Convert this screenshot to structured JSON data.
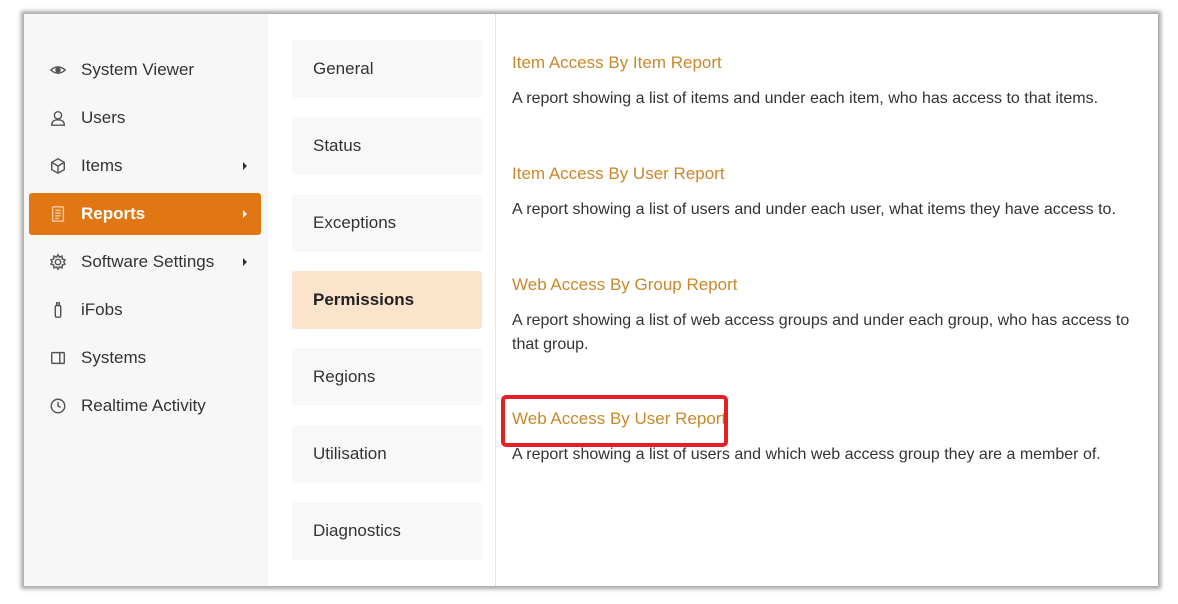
{
  "sidebar": {
    "items": [
      {
        "label": "System Viewer",
        "icon": "eye-icon",
        "has_submenu": false
      },
      {
        "label": "Users",
        "icon": "user-icon",
        "has_submenu": false
      },
      {
        "label": "Items",
        "icon": "cube-icon",
        "has_submenu": true
      },
      {
        "label": "Reports",
        "icon": "report-icon",
        "has_submenu": true,
        "active": true
      },
      {
        "label": "Software Settings",
        "icon": "gear-icon",
        "has_submenu": true
      },
      {
        "label": "iFobs",
        "icon": "fob-icon",
        "has_submenu": false
      },
      {
        "label": "Systems",
        "icon": "window-icon",
        "has_submenu": false
      },
      {
        "label": "Realtime Activity",
        "icon": "clock-icon",
        "has_submenu": false
      }
    ]
  },
  "tabs": [
    {
      "label": "General"
    },
    {
      "label": "Status"
    },
    {
      "label": "Exceptions"
    },
    {
      "label": "Permissions",
      "active": true
    },
    {
      "label": "Regions"
    },
    {
      "label": "Utilisation"
    },
    {
      "label": "Diagnostics"
    }
  ],
  "reports": [
    {
      "title": "Item Access By Item Report",
      "description": "A report showing a list of items and under each item, who has access to that items."
    },
    {
      "title": "Item Access By User Report",
      "description": "A report showing a list of users and under each user, what items they have access to."
    },
    {
      "title": "Web Access By Group Report",
      "description": "A report showing a list of web access groups and under each group, who has access to that group."
    },
    {
      "title": "Web Access By User Report",
      "description": "A report showing a list of users and which web access group they are a member of.",
      "highlighted": true
    }
  ],
  "colors": {
    "accent": "#e07712",
    "active_tab_bg": "#fbe3cc",
    "link": "#c8882b",
    "highlight_border": "#e81e25"
  }
}
